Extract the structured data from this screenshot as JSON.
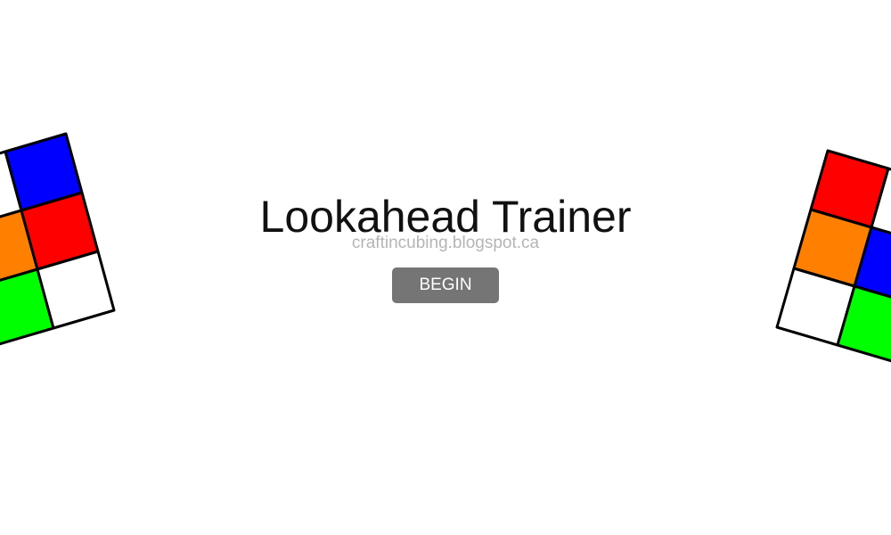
{
  "title": "Lookahead Trainer",
  "subtitle": "craftincubing.blogspot.ca",
  "begin_label": "BEGIN",
  "colors": {
    "background": "#ffffff",
    "button": "#757575",
    "title": "#111111",
    "subtitle": "#b5b5b5",
    "sticker_red": "#ff0000",
    "sticker_blue": "#0000ff",
    "sticker_orange": "#ff8000",
    "sticker_green": "#00ff00",
    "sticker_white": "#ffffff"
  },
  "left_cube": {
    "stickers": [
      [
        "white",
        "blue"
      ],
      [
        "orange",
        "red"
      ],
      [
        "green",
        "white"
      ]
    ]
  },
  "right_cube": {
    "stickers": [
      [
        "red",
        "white"
      ],
      [
        "orange",
        "blue"
      ],
      [
        "white",
        "green"
      ]
    ]
  }
}
